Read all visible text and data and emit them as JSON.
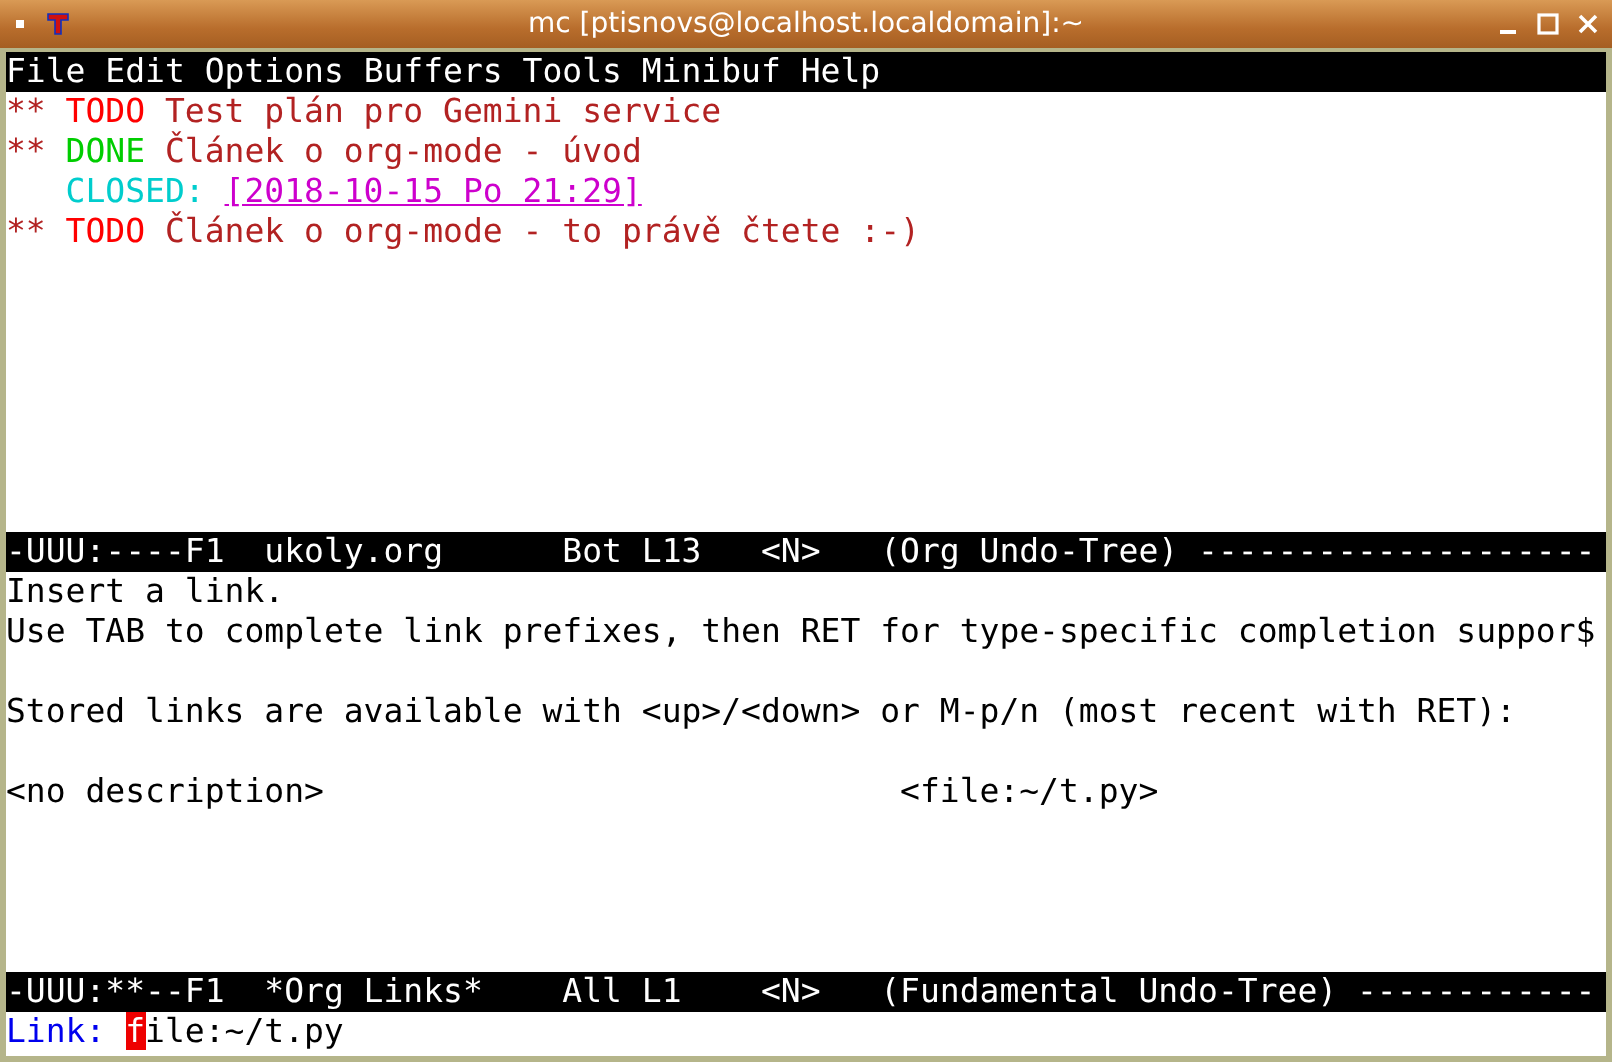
{
  "window": {
    "title": "mc [ptisnovs@localhost.localdomain]:~"
  },
  "menu": [
    "File",
    "Edit",
    "Options",
    "Buffers",
    "Tools",
    "Minibuf",
    "Help"
  ],
  "org_lines": [
    {
      "kind": "heading",
      "bullet": "**",
      "keyword": "TODO",
      "done": false,
      "title": "Test plán pro Gemini service"
    },
    {
      "kind": "heading",
      "bullet": "**",
      "keyword": "DONE",
      "done": true,
      "title": "Článek o org-mode - úvod"
    },
    {
      "kind": "closed",
      "label": "CLOSED:",
      "timestamp": "[2018-10-15 Po 21:29]"
    },
    {
      "kind": "heading",
      "bullet": "**",
      "keyword": "TODO",
      "done": false,
      "title": "Článek o org-mode - to právě čtete :-)"
    }
  ],
  "mode_line_top": "-UUU:----F1  ukoly.org      Bot L13   <N>   (Org Undo-Tree) --------------------",
  "help": {
    "intro": "Insert a link.",
    "tip": "Use TAB to complete link prefixes, then RET for type-specific completion suppor$",
    "stored": "Stored links are available with <up>/<down> or M-p/n (most recent with RET):",
    "links": [
      {
        "description": "<no description>",
        "target": "<file:~/t.py>"
      }
    ]
  },
  "mode_line_bottom": "-UUU:**--F1  *Org Links*    All L1    <N>   (Fundamental Undo-Tree) ------------",
  "minibuffer": {
    "prompt": "Link:",
    "cursor_char": "f",
    "rest": "ile:~/t.py"
  }
}
